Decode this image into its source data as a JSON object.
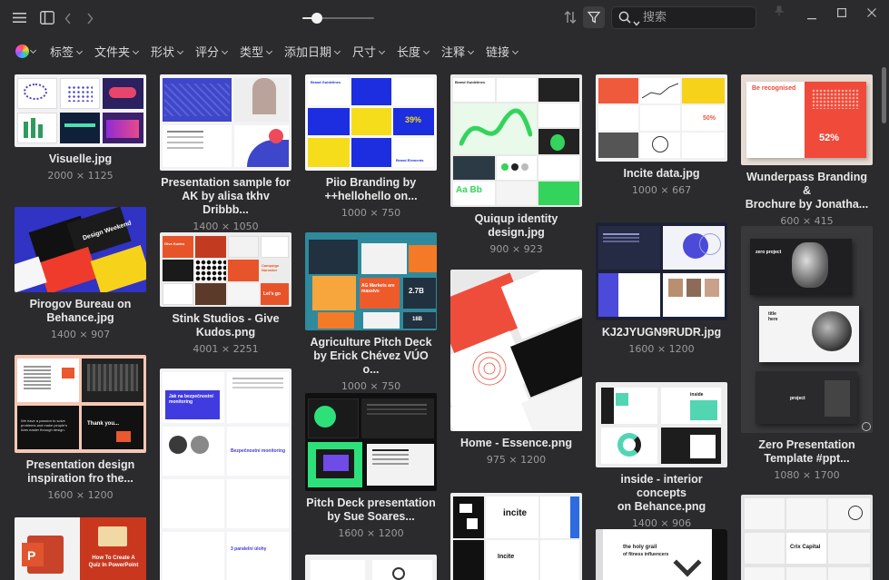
{
  "toolbar": {
    "menu_icon": "hamburger-icon",
    "sidebar_icon": "sidebar-toggle-icon",
    "back_icon": "chevron-left-icon",
    "forward_icon": "chevron-right-icon",
    "zoom_level": 0.2,
    "sort_icon": "sort-icon",
    "filter_icon": "funnel-icon",
    "search_placeholder": "搜索",
    "pin_icon": "pin-icon",
    "minimize_icon": "minimize-icon",
    "maximize_icon": "maximize-icon",
    "close_icon": "close-icon"
  },
  "filters": {
    "color_icon": "color-wheel-icon",
    "items": [
      "标签",
      "文件夹",
      "形状",
      "评分",
      "类型",
      "添加日期",
      "尺寸",
      "长度",
      "注释",
      "链接"
    ]
  },
  "items": [
    {
      "name": "Visuelle.jpg",
      "size": "2000 × 1125"
    },
    {
      "name": "Pirogov Bureau on Behance.jpg",
      "line1": "Pirogov Bureau on",
      "line2": "Behance.jpg",
      "size": "1400 × 907"
    },
    {
      "name": "Presentation design inspiration fro the...",
      "line1": "Presentation design",
      "line2": "inspiration fro the...",
      "size": "1600 × 1200"
    },
    {
      "name": "How To Create A Quiz In PowerPoint",
      "thumb_text1": "How To Create A",
      "thumb_text2": "Quiz In PowerPoint"
    },
    {
      "name": "Presentation sample for AK by alisa tkhv Dribbb...",
      "line1": "Presentation sample for",
      "line2": "AK by alisa tkhv Dribbb...",
      "size": "1400 × 1050"
    },
    {
      "name": "Stink Studios - Give Kudos.png",
      "line1": "Stink Studios - Give",
      "line2": "Kudos.png",
      "size": "4001 × 2251"
    },
    {
      "name": "Piio Branding by ++hellohello on...",
      "line1": "Piio Branding by",
      "line2": "++hellohello on...",
      "size": "1000 × 750"
    },
    {
      "name": "Agriculture Pitch Deck by Erick Chévez VÚO o...",
      "line1": "Agriculture Pitch Deck",
      "line2": "by Erick Chévez VÚO o...",
      "size": "1000 × 750"
    },
    {
      "name": "Pitch Deck presentation by Sue Soares...",
      "line1": "Pitch Deck presentation",
      "line2": "by Sue Soares...",
      "size": "1600 × 1200"
    },
    {
      "name": "Quiqup identity design.jpg",
      "line1": "Quiqup identity",
      "line2": "design.jpg",
      "size": "900 × 923"
    },
    {
      "name": "Home - Essence.png",
      "size": "975 × 1200"
    },
    {
      "name": "incite",
      "thumb_text1": "incite"
    },
    {
      "name": "Incite data.jpg",
      "size": "1000 × 667"
    },
    {
      "name": "KJ2JYUGN9RUDR.jpg",
      "size": "1600 × 1200"
    },
    {
      "name": "inside - interior concepts on Behance.png",
      "line1": "inside - interior concepts",
      "line2": "on Behance.png",
      "size": "1400 × 906"
    },
    {
      "name": "the holy grail of fitness influencers",
      "thumb_text1": "the holy grail",
      "thumb_text2": "of fitness influencers"
    },
    {
      "name": "Wunderpass Branding & Brochure by Jonatha...",
      "line1": "Wunderpass Branding &",
      "line2": "Brochure by Jonatha...",
      "size": "600 × 415"
    },
    {
      "name": "Zero Presentation Template #ppt...",
      "line1": "Zero Presentation",
      "line2": "Template #ppt...",
      "size": "1080 × 1700"
    },
    {
      "name": "Crix Capital",
      "thumb_text1": "Crix Capital"
    }
  ],
  "thumb_texts": {
    "visuelle": "Visuelle",
    "design_weekend": "Design Weekend",
    "thank_you": "Thank you...",
    "we_have_a_passion": "We have a passion to solve problems and make people's lives easier through design.",
    "jak_na": "Jak na bezpečnostní monitoring",
    "bezpecnostni": "Bezpečnostní monitoring",
    "tri_paralelni": "3 paralelní úlohy",
    "brand_guidelines": "Brand Guidelines",
    "brand_elements": "Brand Elements",
    "percent_39": "39%",
    "ag_markets": "AG Markets are massive",
    "value_27b": "2.7B",
    "value_18b": "18B",
    "give_kudos": "Give Kudos",
    "campaign_narrative": "Campaign Narrative",
    "lets_go": "Let's go",
    "quiqup": "Quiqup",
    "aa_bb": "Aa Bb",
    "be_recognised": "Be recognised",
    "percent_52": "52%",
    "percent_50": "50%",
    "zero_project": "zero project",
    "title_here": "title here",
    "project": "project",
    "quiqup_title": "Brand Guidelines",
    "inside": "inside",
    "incite_small": "Incite"
  },
  "colors": {
    "background": "#2b2b2d",
    "accent_blue": "#2f3bd6",
    "accent_red": "#e3503a",
    "accent_green": "#27d07b",
    "accent_yellow": "#f7d21e"
  }
}
